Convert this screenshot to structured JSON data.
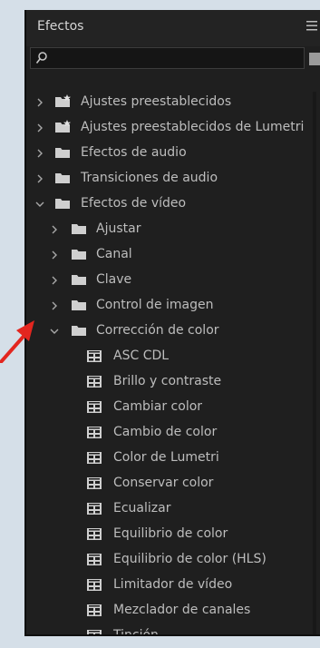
{
  "panel": {
    "title": "Efectos",
    "menu_icon": "hamburger-icon"
  },
  "search": {
    "value": "",
    "icon": "search-icon"
  },
  "tree": [
    {
      "label": "Ajustes preestablecidos",
      "level": 0,
      "type": "preset-folder",
      "expanded": false
    },
    {
      "label": "Ajustes preestablecidos de Lumetri",
      "level": 0,
      "type": "preset-folder",
      "expanded": false
    },
    {
      "label": "Efectos de audio",
      "level": 0,
      "type": "folder",
      "expanded": false
    },
    {
      "label": "Transiciones de audio",
      "level": 0,
      "type": "folder",
      "expanded": false
    },
    {
      "label": "Efectos de vídeo",
      "level": 0,
      "type": "folder",
      "expanded": true
    },
    {
      "label": "Ajustar",
      "level": 1,
      "type": "folder",
      "expanded": false
    },
    {
      "label": "Canal",
      "level": 1,
      "type": "folder",
      "expanded": false
    },
    {
      "label": "Clave",
      "level": 1,
      "type": "folder",
      "expanded": false
    },
    {
      "label": "Control de imagen",
      "level": 1,
      "type": "folder",
      "expanded": false
    },
    {
      "label": "Corrección de color",
      "level": 1,
      "type": "folder",
      "expanded": true
    },
    {
      "label": "ASC CDL",
      "level": 2,
      "type": "effect"
    },
    {
      "label": "Brillo y contraste",
      "level": 2,
      "type": "effect"
    },
    {
      "label": "Cambiar color",
      "level": 2,
      "type": "effect"
    },
    {
      "label": "Cambio de color",
      "level": 2,
      "type": "effect"
    },
    {
      "label": "Color de Lumetri",
      "level": 2,
      "type": "effect"
    },
    {
      "label": "Conservar color",
      "level": 2,
      "type": "effect"
    },
    {
      "label": "Ecualizar",
      "level": 2,
      "type": "effect"
    },
    {
      "label": "Equilibrio de color",
      "level": 2,
      "type": "effect"
    },
    {
      "label": "Equilibrio de color (HLS)",
      "level": 2,
      "type": "effect"
    },
    {
      "label": "Limitador de vídeo",
      "level": 2,
      "type": "effect"
    },
    {
      "label": "Mezclador de canales",
      "level": 2,
      "type": "effect"
    },
    {
      "label": "Tinción",
      "level": 2,
      "type": "effect"
    }
  ],
  "annotation": {
    "arrow_color": "#e3261f",
    "target": "Corrección de color"
  },
  "colors": {
    "panel_bg": "#1f1f1f",
    "text": "#bdbdbd",
    "icon": "#d0d0d0",
    "page_bg": "#d5dfe8"
  }
}
